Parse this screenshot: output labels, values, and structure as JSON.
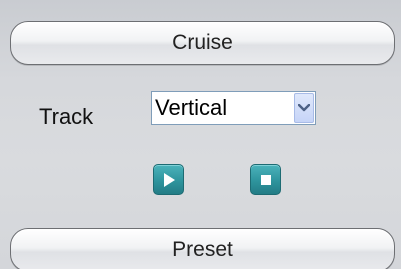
{
  "cruise": {
    "label": "Cruise"
  },
  "track": {
    "label": "Track",
    "selected": "Vertical"
  },
  "controls": {
    "play_icon": "play-icon",
    "stop_icon": "stop-icon",
    "accent": "#2e949d"
  },
  "preset": {
    "label": "Preset"
  }
}
